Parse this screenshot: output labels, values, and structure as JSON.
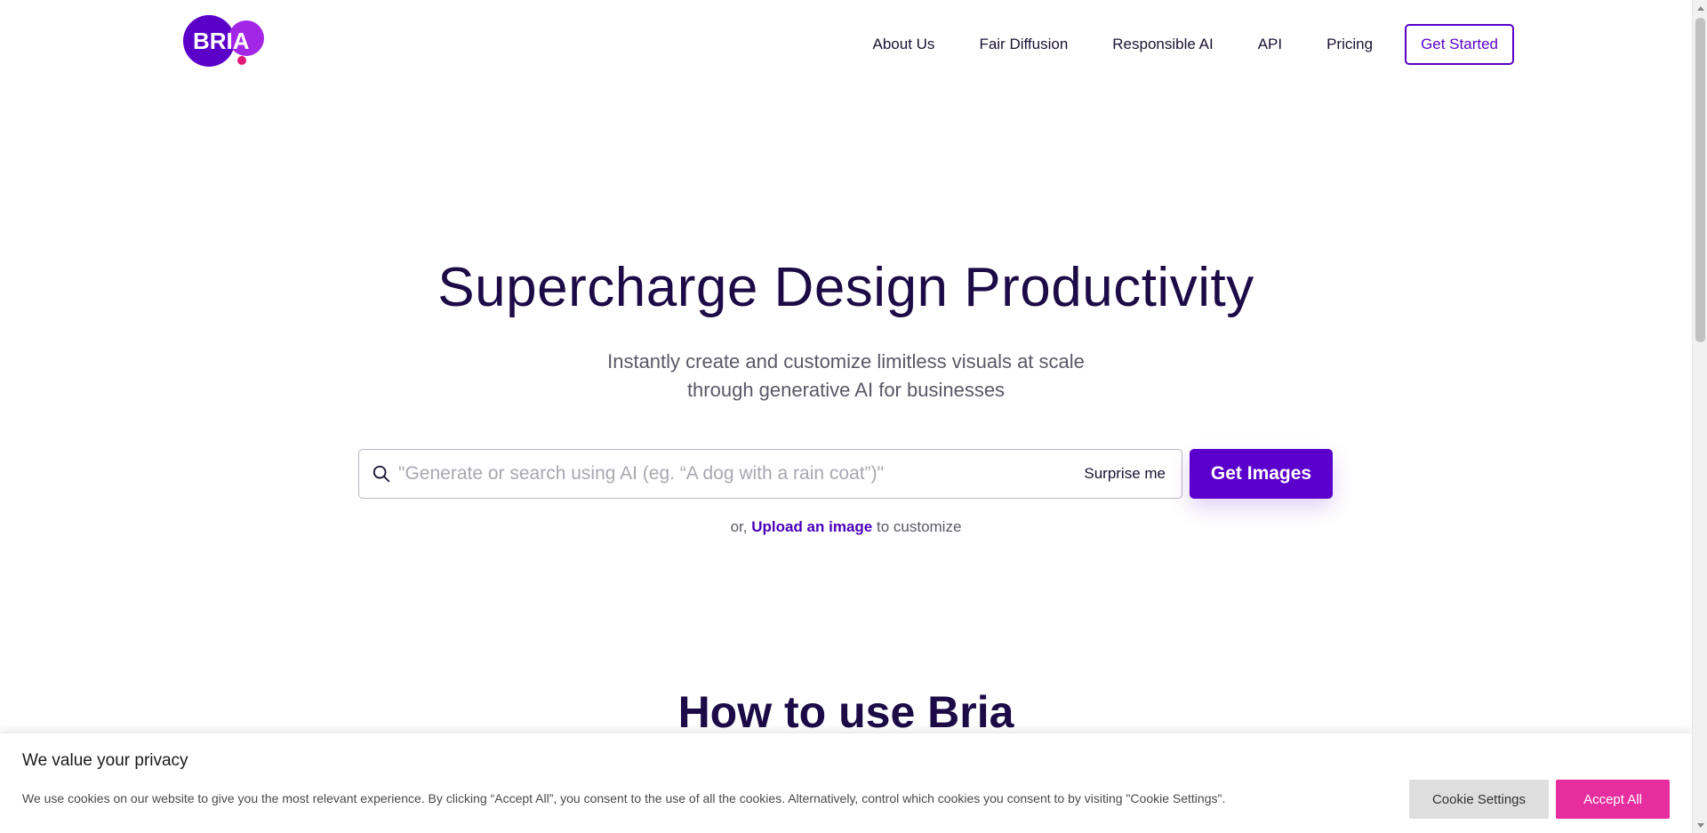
{
  "header": {
    "logo_text": "BRIA",
    "nav": [
      {
        "label": "About Us"
      },
      {
        "label": "Fair Diffusion"
      },
      {
        "label": "Responsible AI"
      },
      {
        "label": "API"
      },
      {
        "label": "Pricing"
      }
    ],
    "cta_label": "Get Started"
  },
  "hero": {
    "title": "Supercharge Design Productivity",
    "subtitle_line1": "Instantly create and customize limitless visuals at scale",
    "subtitle_line2": "through generative AI for businesses",
    "search_placeholder": "\"Generate or search using AI (eg. “A dog with a rain coat”)\"",
    "search_value": "",
    "surprise_label": "Surprise me",
    "submit_label": "Get Images",
    "upload_prefix": "or,",
    "upload_link": "Upload an image",
    "upload_suffix": "to customize"
  },
  "section": {
    "how_title": "How to use Bria"
  },
  "cookie": {
    "title": "We value your privacy",
    "text": "We use cookies on our website to give you the most relevant experience. By clicking “Accept All”, you consent to the use of all the cookies. Alternatively, control which cookies you consent to by visiting \"Cookie Settings\".",
    "settings_label": "Cookie Settings",
    "accept_label": "Accept All"
  },
  "colors": {
    "brand": "#5b00cc",
    "accent_pink": "#e62e9e",
    "heading": "#1c0b46"
  },
  "icons": {
    "search": "search-icon",
    "logo_dot": "logo-dot-icon"
  }
}
